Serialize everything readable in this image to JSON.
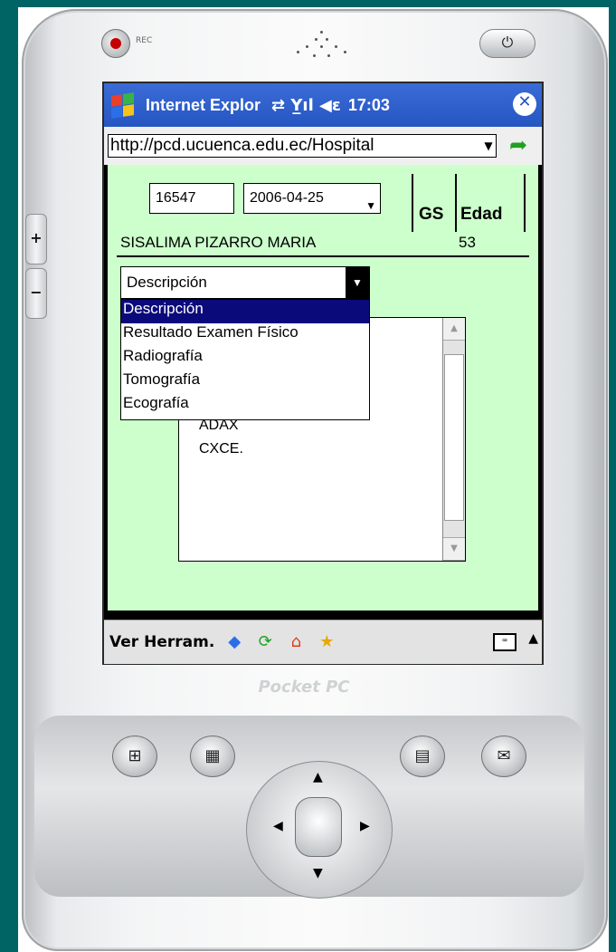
{
  "device": {
    "rec_label": "REC",
    "side_plus": "+",
    "side_minus": "−",
    "brand": "Pocket PC"
  },
  "taskbar": {
    "title": "Internet Explor",
    "status_icons": "⇄ Y̲ıl ◀ε",
    "time": "17:03",
    "close": "✕"
  },
  "address": {
    "url": "http://pcd.ucuenca.edu.ec/Hospital",
    "go": "➦"
  },
  "form": {
    "record_id": "16547",
    "date": "2006-04-25",
    "col_gs": "GS",
    "col_edad": "Edad",
    "patient_name": "SISALIMA PIZARRO MARIA",
    "age": "53",
    "select_value": "Descripción",
    "options": [
      "Descripción",
      "Resultado Examen Físico",
      "Radiografía",
      "Tomografía",
      "Ecografía"
    ],
    "text_lines": [
      "ADAX",
      "CXCE."
    ]
  },
  "menubar": {
    "ver": "Ver",
    "herram": "Herram."
  },
  "colors": {
    "teal": "#006464",
    "content_bg": "#ccffcc",
    "taskbar": "#2556c2",
    "selected_option": "#0a0a7a"
  }
}
